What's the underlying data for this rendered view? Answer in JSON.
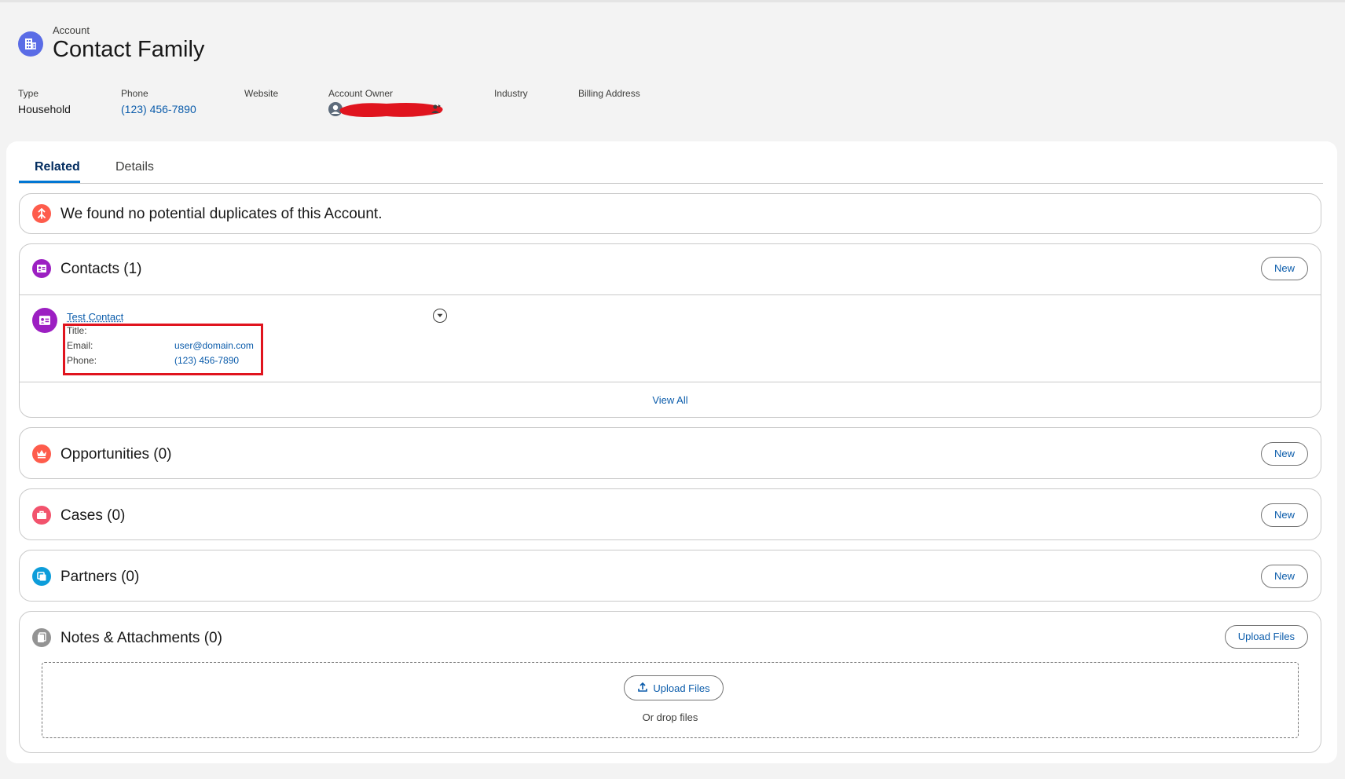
{
  "header": {
    "kicker": "Account",
    "title": "Contact Family",
    "fields": [
      {
        "label": "Type",
        "value": "Household"
      },
      {
        "label": "Phone",
        "value": "(123) 456-7890"
      },
      {
        "label": "Website",
        "value": ""
      },
      {
        "label": "Account Owner",
        "value": ""
      },
      {
        "label": "Industry",
        "value": ""
      },
      {
        "label": "Billing Address",
        "value": ""
      }
    ]
  },
  "tabs": [
    {
      "label": "Related",
      "active": true
    },
    {
      "label": "Details",
      "active": false
    }
  ],
  "duplicates": {
    "message": "We found no potential duplicates of this Account."
  },
  "contacts": {
    "title": "Contacts (1)",
    "new_label": "New",
    "items": [
      {
        "name": "Test Contact",
        "title_label": "Title:",
        "title_value": "",
        "email_label": "Email:",
        "email_value": "user@domain.com",
        "phone_label": "Phone:",
        "phone_value": "(123) 456-7890"
      }
    ],
    "view_all": "View All"
  },
  "opportunities": {
    "title": "Opportunities (0)",
    "new_label": "New"
  },
  "cases": {
    "title": "Cases (0)",
    "new_label": "New"
  },
  "partners": {
    "title": "Partners (0)",
    "new_label": "New"
  },
  "notes": {
    "title": "Notes & Attachments (0)",
    "upload_label": "Upload Files",
    "drop_upload_label": "Upload Files",
    "drop_text": "Or drop files"
  },
  "colors": {
    "account_icon": "#5a6ce6",
    "duplicates_icon": "#fe5c4c",
    "contacts_icon": "#9c1fc2",
    "opportunities_icon": "#fe5c4c",
    "cases_icon": "#f2536d",
    "partners_icon": "#0d9dda",
    "notes_icon": "#939393",
    "link": "#0b5cab",
    "highlight_box": "#e0141e",
    "redaction": "#e0141e"
  },
  "icons": {
    "account": "building-icon",
    "duplicates": "merge-icon",
    "contacts": "contact-card-icon",
    "opportunities": "crown-icon",
    "cases": "briefcase-icon",
    "partners": "partners-icon",
    "notes": "document-icon",
    "owner": "user-avatar-icon",
    "change_owner": "change-owner-icon",
    "row_menu": "chevron-down-icon",
    "upload": "upload-icon"
  }
}
